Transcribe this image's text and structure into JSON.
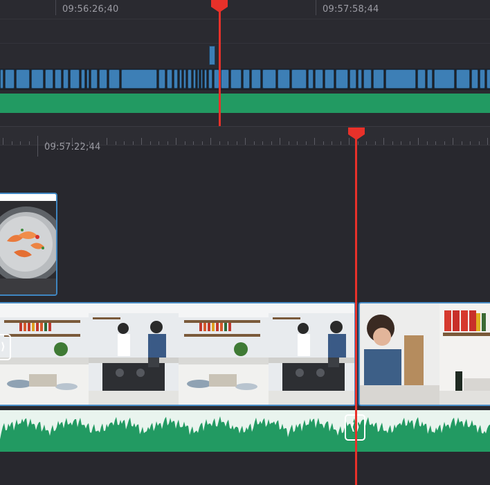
{
  "timeline": {
    "upper_ruler": {
      "timecodes": [
        "09:56:26;40",
        "09:57:58;44"
      ]
    },
    "lower_ruler": {
      "timecode": "09:57:22;44"
    }
  },
  "colors": {
    "background": "#28282e",
    "clip_blue": "#3d7fb6",
    "audio_green": "#229a62",
    "playhead_red": "#e8312a",
    "clip_selected_border": "#4b8fc9"
  },
  "clips": {
    "v2": {
      "thumbnail": "shrimp-in-pan"
    },
    "v1": [
      {
        "thumbnail": "kitchen-wide"
      },
      {
        "thumbnail": "chef-cooking"
      },
      {
        "thumbnail": "kitchen-wide"
      },
      {
        "thumbnail": "chef-cooking"
      },
      {
        "thumbnail": "chef-chopping"
      },
      {
        "thumbnail": "kitchen-shelf"
      }
    ]
  },
  "icons": {
    "trim_handle": "trim-handle-icon",
    "playhead": "playhead-icon"
  }
}
